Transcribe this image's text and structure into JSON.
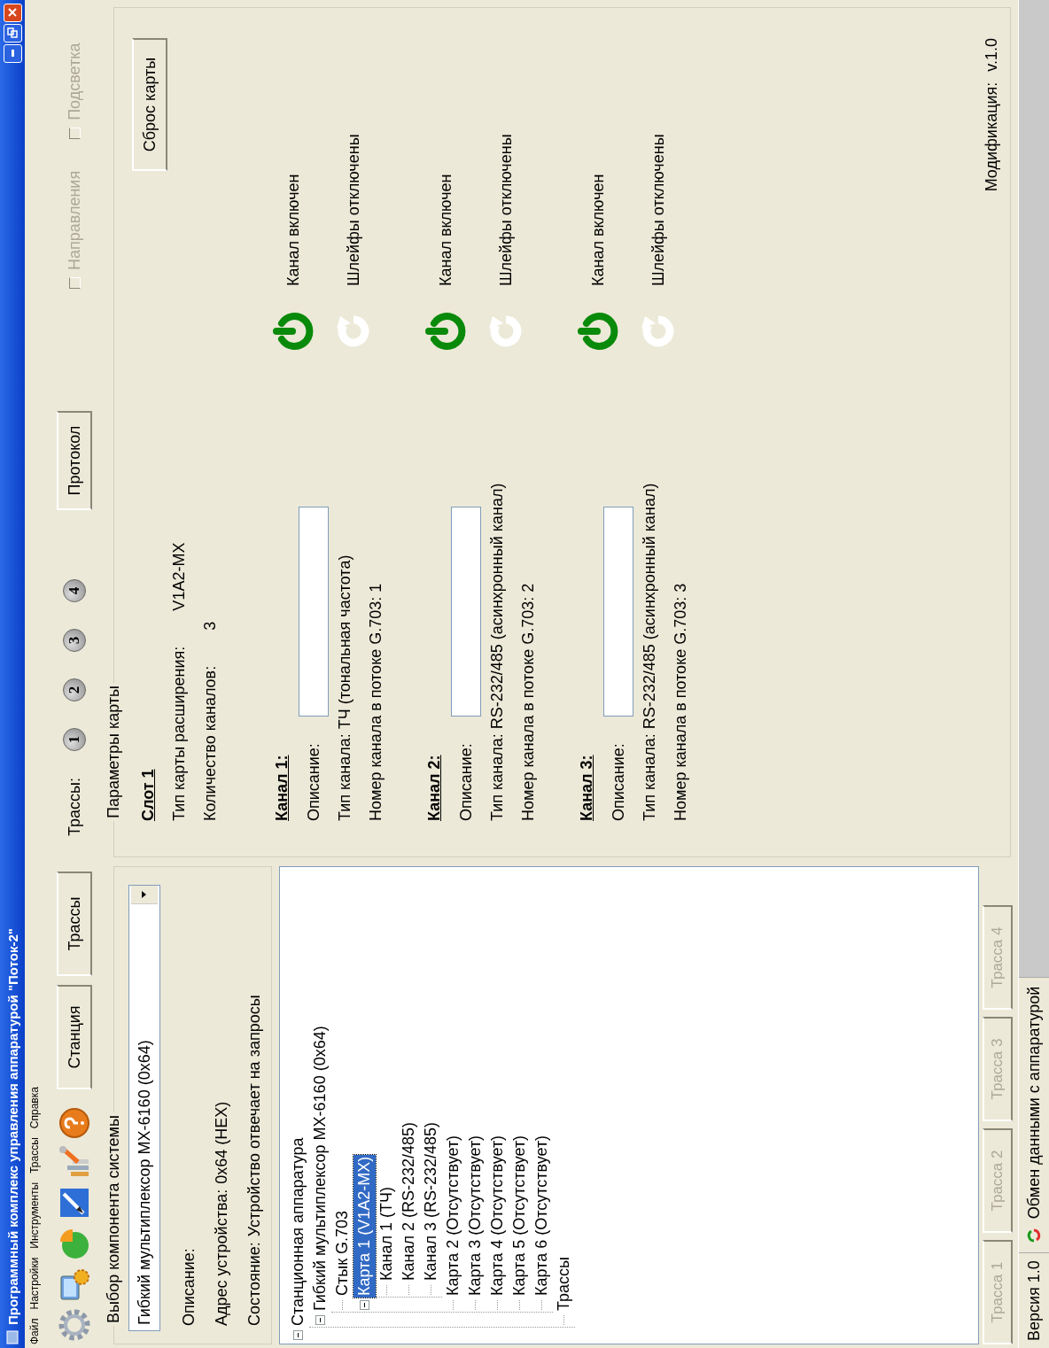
{
  "window": {
    "title": "Программный комплекс управления аппаратурой \"Поток-2\""
  },
  "menu": [
    "Файл",
    "Настройки",
    "Инструменты",
    "Трассы",
    "Справка"
  ],
  "toolbar": {
    "views": [
      "Станция",
      "Трассы"
    ],
    "traces_label": "Трассы:",
    "trace_buttons": [
      "1",
      "2",
      "3",
      "4"
    ],
    "protocol_button": "Протокол",
    "checkboxes": [
      {
        "label": "Направления",
        "checked": false,
        "disabled": true
      },
      {
        "label": "Подсветка",
        "checked": false,
        "disabled": true
      }
    ]
  },
  "component_group": {
    "title": "Выбор компонента системы",
    "combo_value": "Гибкий мультиплексор МХ-6160 (0х64)",
    "fields": [
      {
        "label": "Описание:"
      },
      {
        "label": "Адрес устройства:",
        "value": "0х64 (HEX)"
      },
      {
        "label": "Состояние:",
        "value": "Устройство отвечает на запросы"
      }
    ]
  },
  "tree": {
    "items": [
      {
        "label": "Станционная аппаратура",
        "selected": false,
        "expanded": true,
        "children": [
          {
            "label": "Гибкий мультиплексор МХ-6160 (0х64)",
            "selected": false,
            "expanded": true,
            "children": [
              {
                "label": "Стык G.703",
                "selected": false
              },
              {
                "label": "Карта 1 (V1A2-MX)",
                "selected": true,
                "expanded": true,
                "children": [
                  {
                    "label": "Канал 1 (ТЧ)",
                    "selected": false
                  },
                  {
                    "label": "Канал 2 (RS-232/485)",
                    "selected": false
                  },
                  {
                    "label": "Канал 3 (RS-232/485)",
                    "selected": false
                  }
                ]
              },
              {
                "label": "Карта 2 (Отсутствует)",
                "selected": false
              },
              {
                "label": "Карта 3 (Отсутствует)",
                "selected": false
              },
              {
                "label": "Карта 4 (Отсутствует)",
                "selected": false
              },
              {
                "label": "Карта 5 (Отсутствует)",
                "selected": false
              },
              {
                "label": "Карта 6 (Отсутствует)",
                "selected": false
              }
            ]
          },
          {
            "label": "Трассы",
            "selected": false
          }
        ]
      }
    ]
  },
  "trace_tabs": [
    {
      "label": "Трасса 1",
      "disabled": true
    },
    {
      "label": "Трасса 2",
      "disabled": true
    },
    {
      "label": "Трасса 3",
      "disabled": true
    },
    {
      "label": "Трасса 4",
      "disabled": true
    }
  ],
  "card_params": {
    "title": "Параметры карты",
    "slot": "Слот 1",
    "reset_button": "Сброс карты",
    "fields": [
      {
        "label": "Тип карты расширения:",
        "value": "V1A2-MX"
      },
      {
        "label": "Количество каналов:",
        "value": "3"
      }
    ],
    "channels": [
      {
        "heading": "Канал 1:",
        "description_label": "Описание:",
        "type": "Тип канала: ТЧ (тональная частота)",
        "number": "Номер канала в потоке G.703: 1",
        "enabled": true,
        "enabled_text": "Канал включен",
        "loops": false,
        "loops_text": "Шлейфы отключены"
      },
      {
        "heading": "Канал 2:",
        "description_label": "Описание:",
        "type": "Тип канала: RS-232/485 (асинхронный канал)",
        "number": "Номер канала в потоке G.703: 2",
        "enabled": true,
        "enabled_text": "Канал включен",
        "loops": false,
        "loops_text": "Шлейфы отключены"
      },
      {
        "heading": "Канал 3:",
        "description_label": "Описание:",
        "type": "Тип канала: RS-232/485 (асинхронный канал)",
        "number": "Номер канала в потоке G.703: 3",
        "enabled": true,
        "enabled_text": "Канал включен",
        "loops": false,
        "loops_text": "Шлейфы отключены"
      }
    ],
    "modification": {
      "label": "Модификация:",
      "value": "v.1.0"
    }
  },
  "status_bar": [
    "Версия 1.0",
    "Обмен данными с аппаратурой"
  ]
}
